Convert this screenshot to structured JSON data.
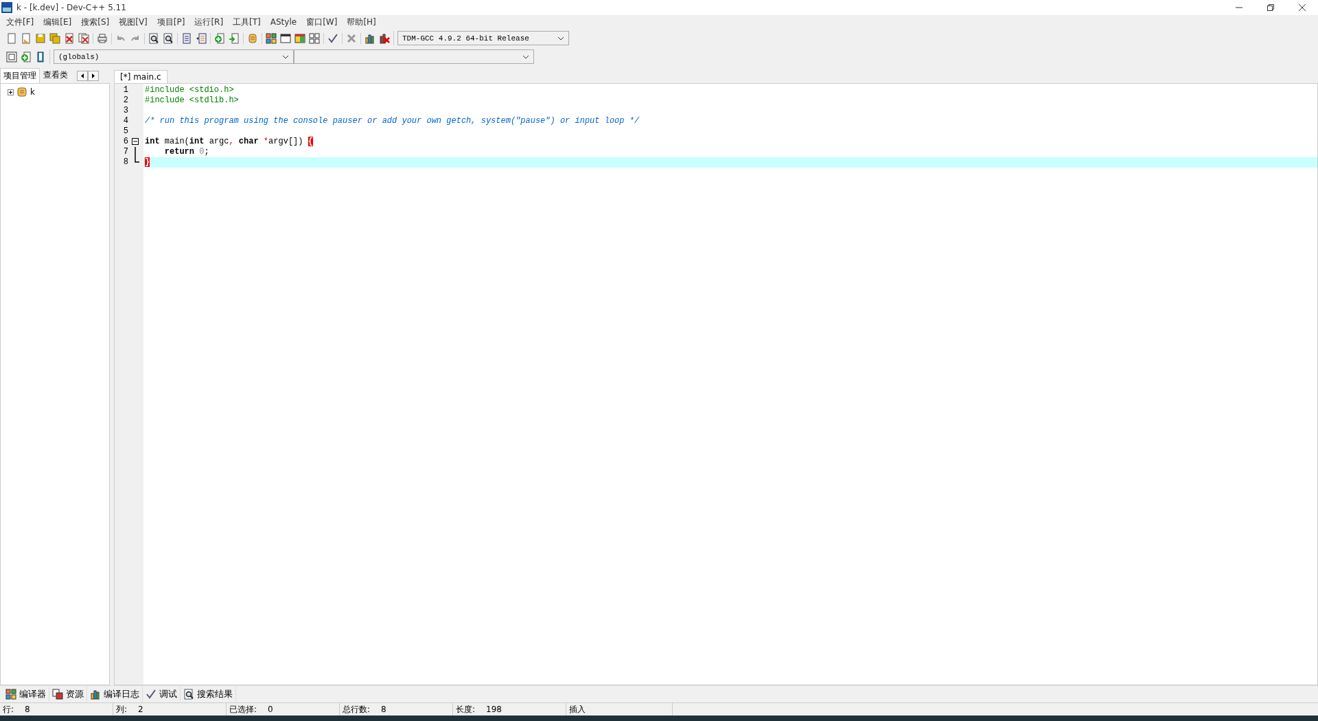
{
  "window": {
    "title": "k - [k.dev] - Dev-C++ 5.11"
  },
  "menu": [
    "文件[F]",
    "编辑[E]",
    "搜索[S]",
    "视图[V]",
    "项目[P]",
    "运行[R]",
    "工具[T]",
    "AStyle",
    "窗口[W]",
    "帮助[H]"
  ],
  "compiler_select": {
    "value": "TDM-GCC 4.9.2 64-bit Release"
  },
  "scope_select": {
    "value": "(globals)"
  },
  "panel_tabs": [
    {
      "label": "项目管理",
      "selected": true
    },
    {
      "label": "查看类",
      "selected": false
    }
  ],
  "project_tree": [
    {
      "label": "k",
      "expanded": false
    }
  ],
  "editor_tabs": [
    {
      "label": "[*] main.c",
      "selected": true
    }
  ],
  "code_lines": [
    {
      "number": "1",
      "kind": "plain",
      "current": false,
      "tokens": [
        {
          "kind": "preproc",
          "text": "#include <stdio.h>"
        }
      ]
    },
    {
      "number": "2",
      "kind": "plain",
      "current": false,
      "tokens": [
        {
          "kind": "preproc",
          "text": "#include <stdlib.h>"
        }
      ]
    },
    {
      "number": "3",
      "kind": "plain",
      "current": false
    },
    {
      "number": "4",
      "kind": "plain",
      "current": false,
      "tokens": [
        {
          "kind": "comment",
          "text": "/* run this program using the console pauser or add your own getch, system(\"pause\") or input loop */"
        }
      ]
    },
    {
      "number": "5",
      "kind": "plain",
      "current": false
    },
    {
      "number": "6",
      "kind": "fold-start",
      "current": false,
      "tokens": [
        {
          "kind": "keyword",
          "text": "int"
        },
        {
          "kind": "plain",
          "text": " main("
        },
        {
          "kind": "keyword",
          "text": "int"
        },
        {
          "kind": "plain",
          "text": " argc"
        },
        {
          "kind": "symbol",
          "text": ", "
        },
        {
          "kind": "keyword",
          "text": "char"
        },
        {
          "kind": "symbol",
          "text": " *"
        },
        {
          "kind": "plain",
          "text": "argv[]) "
        },
        {
          "kind": "brace",
          "text": "{"
        }
      ]
    },
    {
      "number": "7",
      "kind": "fold-body",
      "current": false,
      "tokens": [
        {
          "kind": "keyword",
          "text": "    return"
        },
        {
          "kind": "number",
          "text": " 0"
        },
        {
          "kind": "plain",
          "text": ";"
        }
      ]
    },
    {
      "number": "8",
      "kind": "fold-end",
      "current": true,
      "tokens": [
        {
          "kind": "brace",
          "text": "}"
        }
      ]
    }
  ],
  "bottom_tabs": [
    {
      "label": "编译器",
      "selected": false
    },
    {
      "label": "资源",
      "selected": false
    },
    {
      "label": "编译日志",
      "selected": false
    },
    {
      "label": "调试",
      "selected": false
    },
    {
      "label": "搜索结果",
      "selected": false
    }
  ],
  "status_bar": [
    {
      "label": "行:",
      "value": "8"
    },
    {
      "label": "列:",
      "value": "2"
    },
    {
      "label": "已选择:",
      "value": "0"
    },
    {
      "label": "总行数:",
      "value": "8"
    },
    {
      "label": "长度:",
      "value": "198"
    },
    {
      "label": "插入"
    }
  ]
}
